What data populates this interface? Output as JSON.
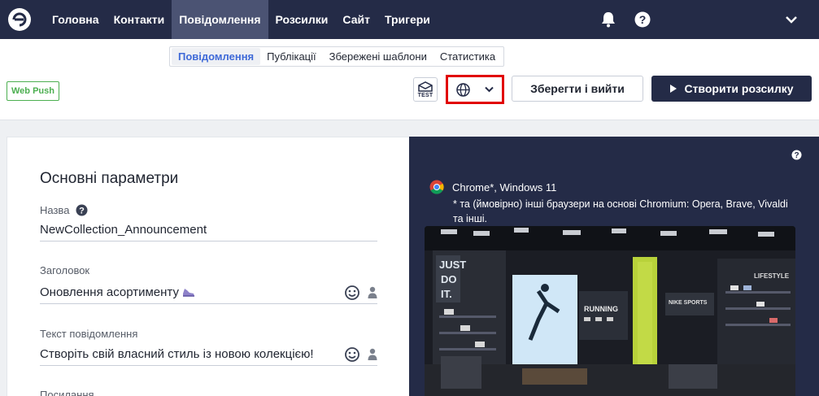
{
  "nav": {
    "items": [
      {
        "label": "Головна"
      },
      {
        "label": "Контакти"
      },
      {
        "label": "Повідомлення"
      },
      {
        "label": "Розсилки"
      },
      {
        "label": "Сайт"
      },
      {
        "label": "Тригери"
      }
    ],
    "icons": [
      "bell-icon",
      "help-icon",
      "chevron-down-icon"
    ]
  },
  "subtabs": [
    {
      "label": "Повідомлення"
    },
    {
      "label": "Публікації"
    },
    {
      "label": "Збережені шаблони"
    },
    {
      "label": "Статистика"
    }
  ],
  "toolbar": {
    "badge": "Web Push",
    "test_label": "TEST",
    "save_label": "Зберегти і вийти",
    "create_label": "Створити розсилку"
  },
  "form": {
    "section_title": "Основні параметри",
    "name_label": "Назва",
    "name_value": "NewCollection_Announcement",
    "title_label": "Заголовок",
    "title_value": "Оновлення асортименту",
    "text_label": "Текст повідомлення",
    "text_value": "Створіть свій власний стиль із новою колекцією!",
    "link_label": "Посилання"
  },
  "preview": {
    "browser": "Chrome*, Windows 11",
    "note": "* та (ймовірно) інші браузери на основі Chromium: Opera, Brave, Vivaldi та інші."
  },
  "colors": {
    "nav_bg": "#242b47",
    "nav_active": "#4b5373",
    "accent": "#3f6ad8",
    "badge": "#4caf50",
    "highlight": "#e10000"
  }
}
